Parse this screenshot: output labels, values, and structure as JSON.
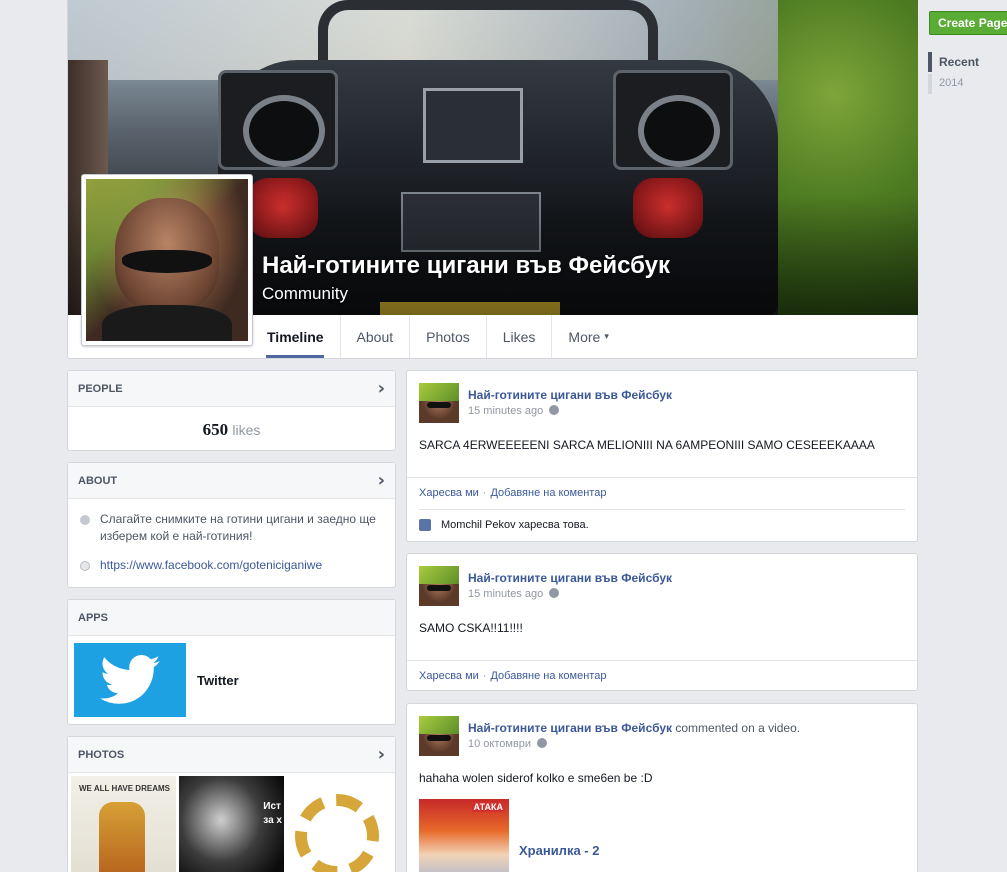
{
  "page": {
    "title": "Най-готините цигани във Фейсбук",
    "category": "Community"
  },
  "tabs": [
    {
      "label": "Timeline",
      "active": true
    },
    {
      "label": "About"
    },
    {
      "label": "Photos"
    },
    {
      "label": "Likes"
    },
    {
      "label": "More"
    }
  ],
  "right_rail": {
    "create_page": "Create Page",
    "timeline_nav": [
      "Recent",
      "2014"
    ]
  },
  "people": {
    "heading": "PEOPLE",
    "likes_count": "650",
    "likes_label": "likes"
  },
  "about": {
    "heading": "ABOUT",
    "description": "Слагайте снимките на готини цигани и заедно ще изберем кой е най-готиния!",
    "url": "https://www.facebook.com/goteniciganiwe"
  },
  "apps": {
    "heading": "APPS",
    "items": [
      {
        "label": "Twitter",
        "icon": "twitter-bird-icon"
      }
    ]
  },
  "photos": {
    "heading": "PHOTOS",
    "thumb1_text": "WE ALL HAVE DREAMS",
    "thumb2_text": "Ист\nза х"
  },
  "posts": [
    {
      "author": "Най-готините цигани във Фейсбук",
      "time": "15 minutes ago",
      "text": "SARCA 4ERWEEEEENI SARCA MELIONIII NA 6AMPEONIII SAMO CESEEEKAAAA",
      "like_label": "Харесва ми",
      "comment_label": "Добавяне на коментар",
      "likes_text": "Momchil Pekov харесва това."
    },
    {
      "author": "Най-готините цигани във Фейсбук",
      "time": "15 minutes ago",
      "text": "SAMO CSKA!!11!!!!",
      "like_label": "Харесва ми",
      "comment_label": "Добавяне на коментар"
    },
    {
      "author": "Най-готините цигани във Фейсбук",
      "action": "commented on a video.",
      "time": "10 октомври",
      "text": "hahaha wolen siderof kolko e sme6en be :D",
      "video_title": "Хранилка - 2",
      "video_brand": "АТАКА"
    }
  ],
  "colors": {
    "brand": "#3b5998",
    "create_page_green": "#5aac34",
    "twitter_blue": "#1da1e2",
    "background": "#e9eaed"
  }
}
